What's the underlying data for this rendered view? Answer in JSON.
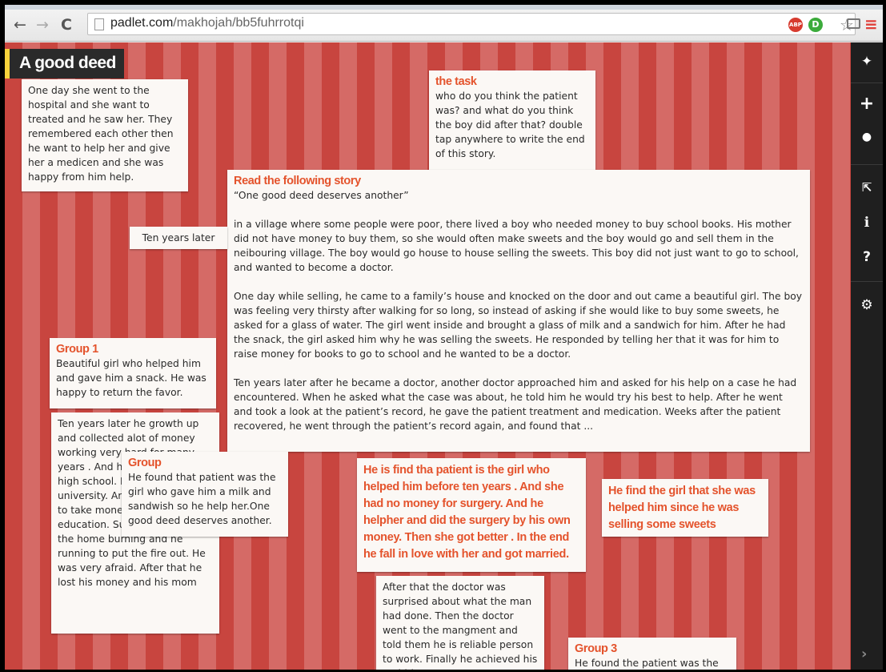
{
  "browser": {
    "back_icon": "←",
    "forward_icon": "→",
    "reload_icon": "C",
    "url_host": "padlet.com",
    "url_path": "/makhojah/bb5fuhrrotqi",
    "star_icon": "☆",
    "ext_abp": "ABP",
    "ext_d": "D",
    "menu_icon": "≡"
  },
  "wall": {
    "title": "A good deed",
    "background_colors": [
      "#c8453f",
      "#d56a66"
    ]
  },
  "sidebar": {
    "items": [
      {
        "name": "padlet-logo-icon",
        "glyph": "✦"
      },
      {
        "name": "add-post-icon",
        "glyph": "+"
      },
      {
        "name": "profile-icon",
        "glyph": "●"
      },
      {
        "name": "share-icon",
        "glyph": "⇱"
      },
      {
        "name": "info-icon",
        "glyph": "ℹ"
      },
      {
        "name": "help-icon",
        "glyph": "?"
      },
      {
        "name": "settings-icon",
        "glyph": "⚙"
      }
    ],
    "chevron_icon": "›"
  },
  "posts": {
    "p1": {
      "title": "",
      "body": "One day she went to the hospital and she want to treated and he saw her. They remembered each other then he want to help her and give her a medicen and she was happy from him help."
    },
    "task": {
      "title": "the task",
      "body": "who do you think the patient was? and what do you think the boy did after that? double tap anywhere to write the end of this story."
    },
    "story": {
      "title": "Read the following story",
      "body": "“One good deed deserves another”\n\nin a village where some people were poor, there lived a boy who needed money to buy school books. His mother did not have money to buy them, so she would often make sweets and the boy would go and sell them in the neibouring village. The boy would go house to house selling the sweets. This boy did not just want to go to school, and wanted to become a doctor.\n\nOne day while selling, he came to a family’s house and knocked on the door and out came a beautiful girl. The boy was feeling very thirsty after walking for so long, so instead of asking if she would like to buy some sweets, he asked for a glass of water. The girl went inside and brought a glass of milk and a sandwich for him. After he had the snack, the girl asked him why he was selling the sweets. He responded by telling her that it was for him to raise money for books to go to school and he wanted to be a doctor.\n\nTen years later after he became a doctor, another doctor approached him and asked for his help on a case he had encountered. When he asked what the case was about, he told him he would try his best to help. After he went and took a look at the patient’s record, he gave the patient treatment and medication. Weeks after the patient recovered, he went through the patient’s record again, and found that ..."
    },
    "ten_years": {
      "title": "",
      "body": "Ten years later"
    },
    "group1": {
      "title": "Group 1",
      "body": "Beautiful girl who helped him and gave him a snack. He was happy to return the favor."
    },
    "growth": {
      "title": "",
      "body": "Ten years later he growth up and collected alot of money working very hard for many years . And he finished the high school. He want to read in university. And he came home to take money for his education. Suddenly, he found the home burning and he running to put the fire out. He was very afraid. After that he lost his money and his mom"
    },
    "group": {
      "title": "Group",
      "body": "He found that patient was the girl who gave him a milk and sandwish so he help her.One good deed deserves another."
    },
    "hl1": {
      "title": "",
      "body": "He is find tha patient is the girl who helped him before ten years . And she had no money for surgery. And he helpher and did the surgery by his own money. Then she got better . In the end he fall in love with her and got married."
    },
    "hl2": {
      "title": "",
      "body": "He find the girl that she was helped him since he was selling some sweets"
    },
    "after": {
      "title": "",
      "body": "After that the doctor was surprised about what the man had done. Then the doctor went to the mangment and told them he is reliable person to work. Finally he achieved his ambitions."
    },
    "group3": {
      "title": "Group 3",
      "body": "He found the patient was the"
    }
  }
}
